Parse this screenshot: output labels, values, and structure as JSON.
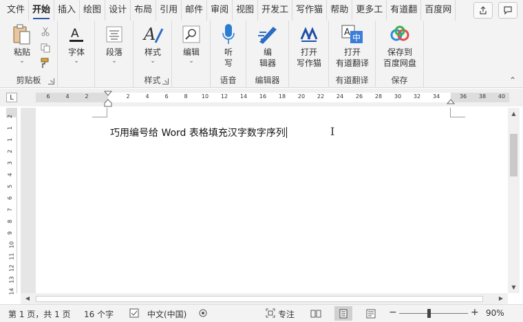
{
  "tabs": [
    "文件",
    "开始",
    "插入",
    "绘图",
    "设计",
    "布局",
    "引用",
    "邮件",
    "审阅",
    "视图",
    "开发工",
    "写作猫",
    "帮助",
    "更多工",
    "有道翻",
    "百度网"
  ],
  "active_tab": "开始",
  "ribbon": {
    "clipboard": {
      "paste_label": "粘贴",
      "group_label": "剪贴板"
    },
    "font": {
      "label": "字体"
    },
    "paragraph": {
      "label": "段落"
    },
    "styles": {
      "label": "样式",
      "group_label": "样式"
    },
    "editing": {
      "label": "编辑"
    },
    "voice": {
      "label_line1": "听",
      "label_line2": "写",
      "group_label": "语音"
    },
    "editor": {
      "label_line1": "编",
      "label_line2": "辑器",
      "group_label": "编辑器"
    },
    "writing_cat": {
      "label_line1": "打开",
      "label_line2": "写作猫"
    },
    "youdao": {
      "label_line1": "打开",
      "label_line2": "有道翻译",
      "group_label": "有道翻译"
    },
    "baidu": {
      "label_line1": "保存到",
      "label_line2": "百度网盘",
      "group_label": "保存"
    }
  },
  "ruler": {
    "h_numbers": [
      "6",
      "4",
      "2",
      "2",
      "4",
      "6",
      "8",
      "10",
      "12",
      "14",
      "16",
      "18",
      "20",
      "22",
      "24",
      "26",
      "28",
      "30",
      "32",
      "34",
      "36",
      "38",
      "40"
    ],
    "v_numbers": [
      "2",
      "1",
      "1",
      "2",
      "3",
      "4",
      "5",
      "6",
      "7",
      "8",
      "9",
      "10",
      "11",
      "12",
      "13",
      "14"
    ]
  },
  "document": {
    "text": "巧用编号给 Word 表格填充汉字数字序列"
  },
  "status": {
    "page": "第 1 页，共 1 页",
    "words": "16 个字",
    "language": "中文(中国)",
    "focus": "专注",
    "zoom": "90%",
    "minus": "−",
    "plus": "+"
  },
  "colors": {
    "accent": "#2b579a",
    "ribbon_bg": "#f3f3f3"
  }
}
